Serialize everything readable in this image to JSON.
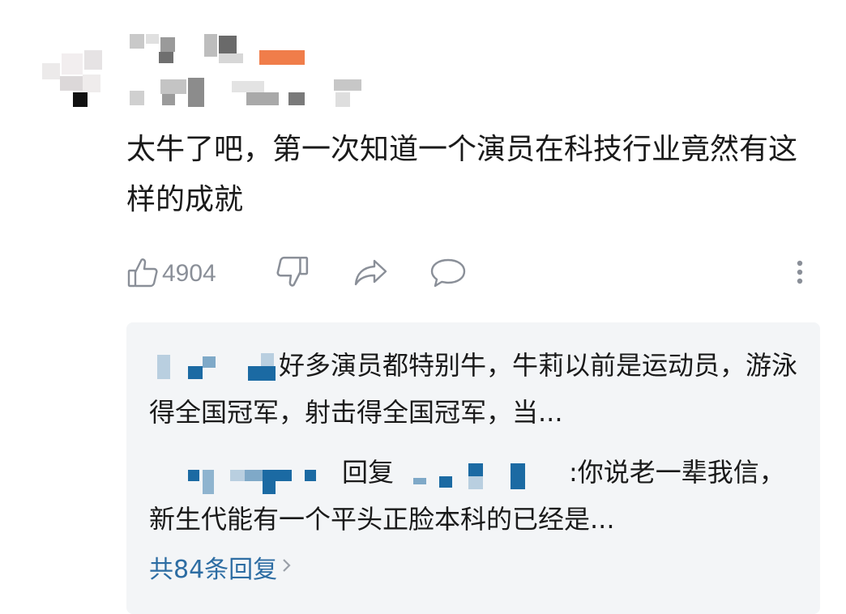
{
  "comment": {
    "text": "太牛了吧，第一次知道一个演员在科技行业竟然有这样的成就",
    "like_count": "4904"
  },
  "actions": {
    "like_icon": "thumbs-up-icon",
    "dislike_icon": "thumbs-down-icon",
    "share_icon": "share-icon",
    "reply_icon": "comment-bubble-icon",
    "more_icon": "more-vertical-icon"
  },
  "replies": [
    {
      "text": "好多演员都特别牛，牛莉以前是运动员，游泳得全国冠军，射击得全国冠军，当..."
    },
    {
      "reply_word": "回复",
      "text": ":你说老一辈我信，新生代能有一个平头正脸本科的已经是..."
    }
  ],
  "total_replies_label": "共84条回复",
  "colors": {
    "accent": "#2d6da3",
    "muted": "#8a8f98",
    "badge": "#f07d4a"
  }
}
